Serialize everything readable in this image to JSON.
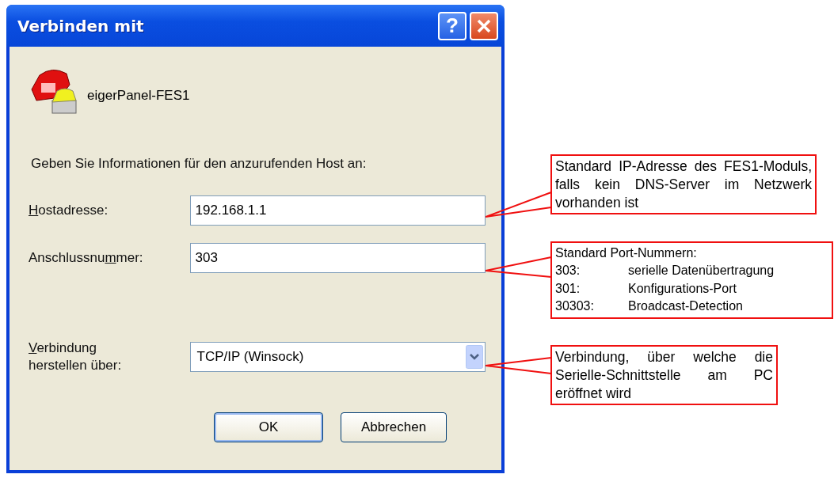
{
  "window": {
    "title": "Verbinden mit",
    "buttons": [
      {
        "kind": "help",
        "label": "?"
      },
      {
        "kind": "close"
      }
    ]
  },
  "connection": {
    "name": "eigerPanel-FES1"
  },
  "instruction": "Geben Sie Informationen für den anzurufenden Host an:",
  "fields": [
    {
      "kind": "text",
      "label": [
        {
          "text": "H",
          "underlined": true
        },
        {
          "text": "ostadresse:",
          "underlined": false
        }
      ],
      "value": "192.168.1.1"
    },
    {
      "kind": "text",
      "label": [
        {
          "text": "Anschlussnu",
          "underlined": false
        },
        {
          "text": "m",
          "underlined": true
        },
        {
          "text": "mer:",
          "underlined": false
        }
      ],
      "value": "303"
    },
    {
      "kind": "dropdown",
      "label": [
        {
          "text": "V",
          "underlined": true
        },
        {
          "text": "erbindung\nherstellen über:",
          "underlined": false
        }
      ],
      "value": "TCP/IP (Winsock)"
    }
  ],
  "buttons": [
    {
      "label": "OK",
      "default": true
    },
    {
      "label": "Abbrechen",
      "default": false
    }
  ],
  "callouts": [
    {
      "kind": "paragraph",
      "text": "Standard IP-Adresse des FES1-Moduls, falls kein DNS-Server im Netzwerk vorhanden ist"
    },
    {
      "kind": "table",
      "heading": "Standard Port-Nummern:",
      "rows": [
        {
          "port": "303:",
          "description": "serielle Datenübertragung"
        },
        {
          "port": "301:",
          "description": "Konfigurations-Port"
        },
        {
          "port": "30303:",
          "description": "Broadcast-Detection"
        }
      ]
    },
    {
      "kind": "paragraph",
      "text": "Verbindung, über welche die Serielle-Schnittstelle am PC eröffnet wird"
    }
  ]
}
